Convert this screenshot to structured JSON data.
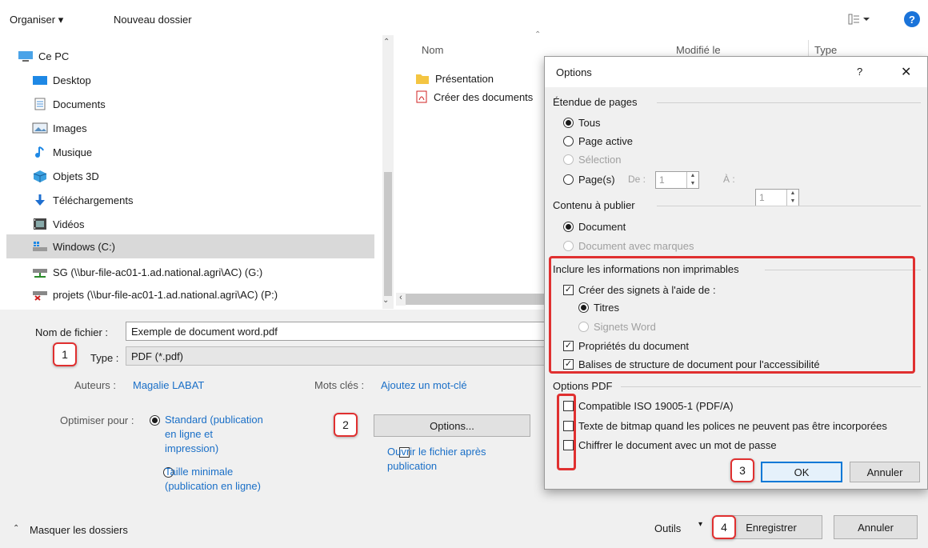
{
  "toolbar": {
    "organise": "Organiser ▾",
    "new_folder": "Nouveau dossier",
    "view_icon": "view-icon",
    "help": "?"
  },
  "nav": {
    "items": [
      {
        "label": "Ce PC",
        "icon": "pc-icon"
      },
      {
        "label": "Desktop",
        "icon": "desktop-icon"
      },
      {
        "label": "Documents",
        "icon": "documents-icon"
      },
      {
        "label": "Images",
        "icon": "images-icon"
      },
      {
        "label": "Musique",
        "icon": "music-icon"
      },
      {
        "label": "Objets 3D",
        "icon": "objects3d-icon"
      },
      {
        "label": "Téléchargements",
        "icon": "download-icon"
      },
      {
        "label": "Vidéos",
        "icon": "video-icon"
      },
      {
        "label": "Windows (C:)",
        "icon": "drive-icon"
      },
      {
        "label": "SG (\\\\bur-file-ac01-1.ad.national.agri\\AC) (G:)",
        "icon": "network-drive-icon"
      },
      {
        "label": "projets (\\\\bur-file-ac01-1.ad.national.agri\\AC) (P:)",
        "icon": "network-drive-disconnected-icon"
      }
    ]
  },
  "filelist": {
    "columns": {
      "name": "Nom",
      "modified": "Modifié le",
      "type": "Type"
    },
    "rows": [
      {
        "name": "Présentation",
        "icon": "folder-icon"
      },
      {
        "name": "Créer des documents",
        "icon": "pdf-icon"
      }
    ]
  },
  "form": {
    "filename_label": "Nom de fichier :",
    "filename_value": "Exemple de document word.pdf",
    "type_label": "Type :",
    "type_value": "PDF (*.pdf)",
    "authors_label": "Auteurs :",
    "authors_value": "Magalie LABAT",
    "keywords_label": "Mots clés :",
    "keywords_value": "Ajoutez un mot-clé",
    "optimize_label": "Optimiser pour :",
    "optimize_standard_1": "Standard (publication",
    "optimize_standard_2": "en ligne et",
    "optimize_standard_3": "impression)",
    "optimize_min_1": "Taille minimale",
    "optimize_min_2": "(publication en ligne)",
    "options_button": "Options...",
    "open_after_1": "Ouvrir le fichier après",
    "open_after_2": "publication",
    "hide_folders": "Masquer les dossiers",
    "tools": "Outils",
    "save": "Enregistrer",
    "cancel": "Annuler"
  },
  "dialog": {
    "title": "Options",
    "help": "?",
    "close": "✕",
    "page_range": {
      "heading": "Étendue de pages",
      "all": "Tous",
      "current": "Page active",
      "selection": "Sélection",
      "pages": "Page(s)",
      "from_label": "De :",
      "from_value": "1",
      "to_label": "À :",
      "to_value": "1"
    },
    "publish": {
      "heading": "Contenu à publier",
      "document": "Document",
      "with_markup": "Document avec marques"
    },
    "nonprint": {
      "heading": "Inclure les informations non imprimables",
      "bookmarks": "Créer des signets à l'aide de :",
      "headings": "Titres",
      "word_bookmarks": "Signets Word",
      "properties": "Propriétés du document",
      "tags": "Balises de structure de document pour l'accessibilité"
    },
    "pdf_options": {
      "heading": "Options PDF",
      "iso": "Compatible ISO 19005-1 (PDF/A)",
      "bitmap": "Texte de bitmap quand les polices ne peuvent pas être incorporées",
      "encrypt": "Chiffrer le document avec un mot de passe"
    },
    "ok": "OK",
    "cancel": "Annuler"
  },
  "badges": {
    "b1": "1",
    "b2": "2",
    "b3": "3",
    "b4": "4"
  },
  "colors": {
    "accent": "#0078d7",
    "annotation": "#e03030",
    "link": "#1a6fc7"
  }
}
